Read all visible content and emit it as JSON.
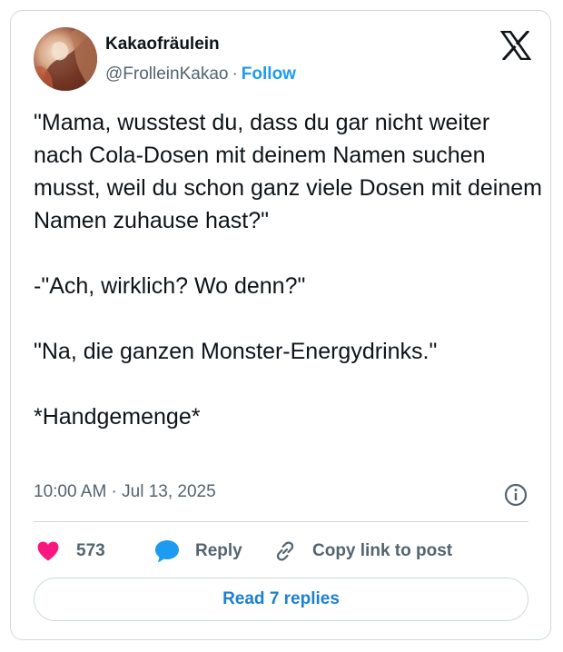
{
  "author": {
    "display_name": "Kakaofräulein",
    "handle": "@FrolleinKakao",
    "separator": "·",
    "follow_label": "Follow"
  },
  "tweet": {
    "paragraphs": [
      "\"Mama, wusstest du, dass du gar nicht weiter nach Cola-Dosen mit deinem Namen suchen musst, weil du schon ganz viele Dosen mit deinem Namen zuhause hast?\"",
      "-\"Ach, wirklich? Wo denn?\"",
      "\"Na, die ganzen Monster-Energydrinks.\"",
      "*Handgemenge*"
    ],
    "timestamp": "10:00 AM · Jul 13, 2025"
  },
  "actions": {
    "like_count": "573",
    "reply_label": "Reply",
    "copy_link_label": "Copy link to post"
  },
  "footer": {
    "read_replies_label": "Read 7 replies"
  },
  "icons": {
    "brand": "x-logo-icon",
    "info": "info-icon",
    "like": "heart-icon",
    "reply": "speech-bubble-icon",
    "copy": "link-icon"
  },
  "colors": {
    "like": "#f91880",
    "reply": "#1d9bf0",
    "link": "#1d9bf0",
    "muted": "#536471",
    "border": "#cfd9de"
  }
}
